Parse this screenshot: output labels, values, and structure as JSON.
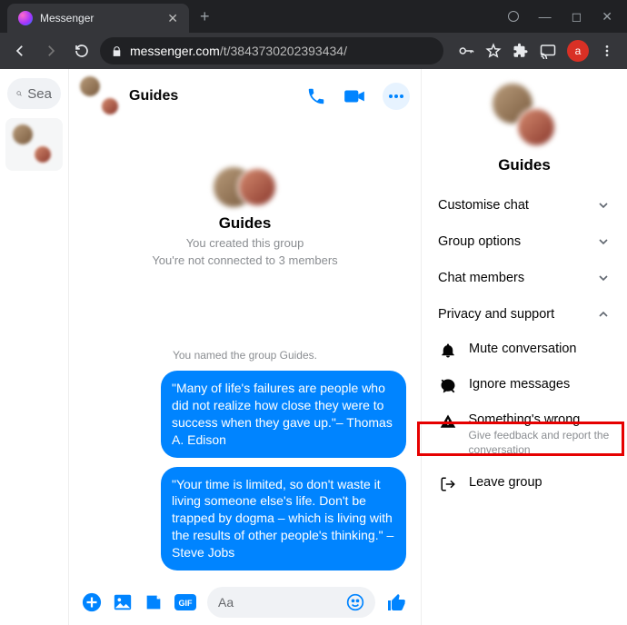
{
  "browser": {
    "tab_title": "Messenger",
    "url_host": "messenger.com",
    "url_path": "/t/3843730202393434/",
    "profile_letter": "a"
  },
  "sidebar": {
    "search_placeholder": "Sea"
  },
  "chat": {
    "title": "Guides",
    "group_name": "Guides",
    "created_line": "You created this group",
    "connected_line": "You're not connected to 3 members",
    "system_named": "You named the group Guides.",
    "messages": [
      "\"Many of life's failures are people who did not realize how close they were to success when they gave up.\"– Thomas A. Edison",
      "\"Your time is limited, so don't waste it living someone else's life. Don't be trapped by dogma – which is living with the results of other people's thinking.\" – Steve Jobs"
    ],
    "composer_placeholder": "Aa"
  },
  "details": {
    "title": "Guides",
    "sections": {
      "customise": "Customise chat",
      "group_options": "Group options",
      "chat_members": "Chat members",
      "privacy": "Privacy and support"
    },
    "privacy_items": {
      "mute": "Mute conversation",
      "ignore": "Ignore messages",
      "wrong_title": "Something's wrong",
      "wrong_sub": "Give feedback and report the conversation",
      "leave": "Leave group"
    }
  }
}
